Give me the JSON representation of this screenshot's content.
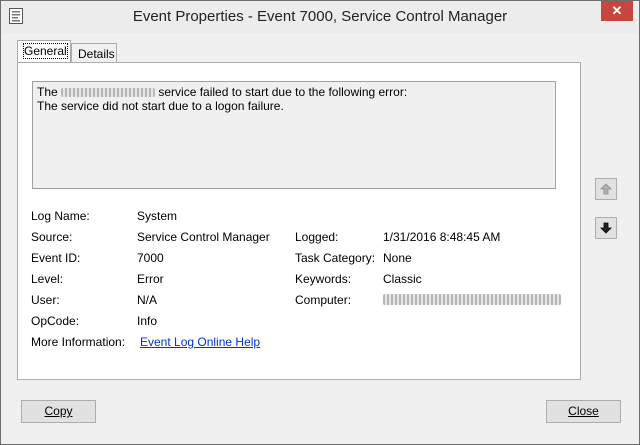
{
  "window": {
    "title": "Event Properties - Event 7000, Service Control Manager",
    "close_label": "✕"
  },
  "tabs": [
    {
      "label": "General",
      "active": true
    },
    {
      "label": "Details",
      "active": false
    }
  ],
  "description": {
    "line1_prefix": "The",
    "line1_suffix": "service failed to start due to the following error:",
    "line2": "The service did not start due to a logon failure."
  },
  "fields": {
    "log_name": {
      "label": "Log Name:",
      "value": "System"
    },
    "source": {
      "label": "Source:",
      "value": "Service Control Manager"
    },
    "event_id": {
      "label": "Event ID:",
      "value": "7000"
    },
    "level": {
      "label": "Level:",
      "value": "Error"
    },
    "user": {
      "label": "User:",
      "value": "N/A"
    },
    "opcode": {
      "label": "OpCode:",
      "value": "Info"
    },
    "more_info": {
      "label": "More Information:",
      "value": "Event Log Online Help"
    },
    "logged": {
      "label": "Logged:",
      "value": "1/31/2016 8:48:45 AM"
    },
    "task_category": {
      "label": "Task Category:",
      "value": "None"
    },
    "keywords": {
      "label": "Keywords:",
      "value": "Classic"
    },
    "computer": {
      "label": "Computer:"
    }
  },
  "icons": {
    "up": "arrow-up-icon",
    "down": "arrow-down-icon"
  },
  "buttons": {
    "copy": "Copy",
    "close": "Close"
  }
}
